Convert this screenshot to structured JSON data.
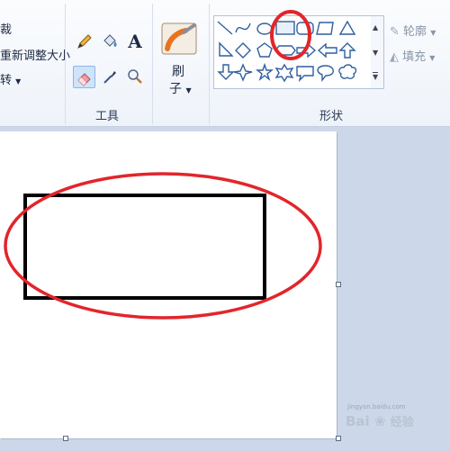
{
  "image_group": {
    "crop_partial": "裁",
    "resize_partial": "重新调整大小",
    "rotate_partial": "转"
  },
  "tools_group": {
    "label": "工具",
    "tools": [
      {
        "name": "pencil-icon"
      },
      {
        "name": "fill-bucket-icon"
      },
      {
        "name": "text-icon",
        "glyph": "A"
      },
      {
        "name": "eraser-icon"
      },
      {
        "name": "color-picker-icon"
      },
      {
        "name": "magnifier-icon"
      }
    ]
  },
  "brushes": {
    "label_line1": "刷",
    "label_line2": "子"
  },
  "shapes_group": {
    "label": "形状",
    "outline_label": "轮廓",
    "fill_label": "填充",
    "selected_shape": "rectangle"
  },
  "watermark": {
    "url": "jingyan.baidu.com",
    "brand": "Bai",
    "brand_suffix": "经验"
  },
  "colors": {
    "annotation_red": "#e2252b",
    "ribbon_bg": "#f5f8fc",
    "workspace_bg": "#ccd8e9"
  }
}
